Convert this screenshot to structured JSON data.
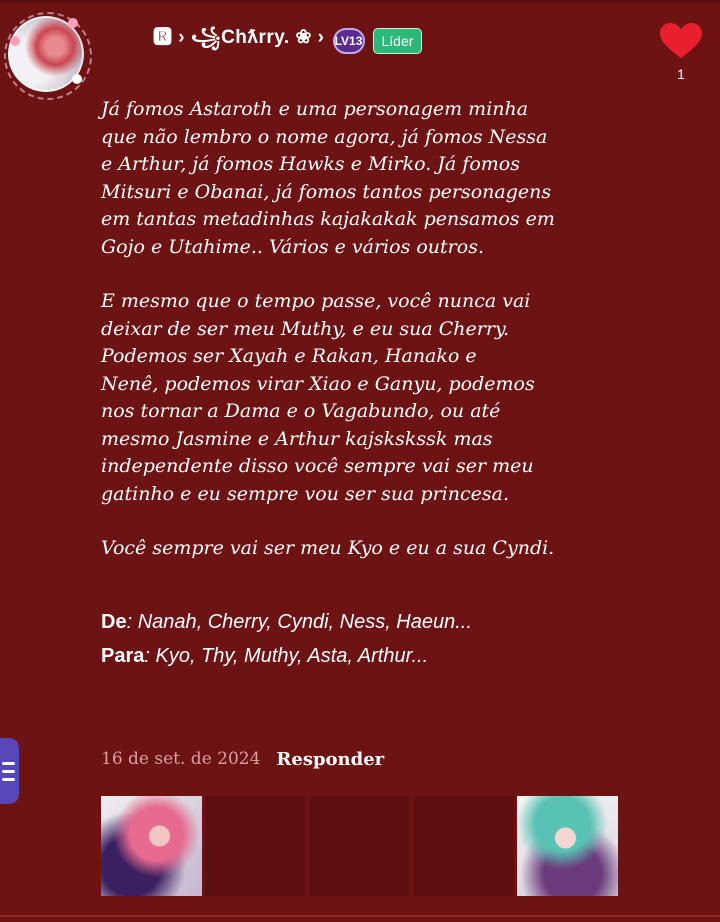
{
  "comment": {
    "username": "🆁 › ꧁Chƛrry. ❀ ›",
    "level_badge": "LV13",
    "role_badge": "Líder",
    "like_count": "1",
    "paragraphs": [
      "Já fomos Astaroth e uma personagem minha\nque não lembro o nome agora, já fomos Nessa\ne Arthur, já fomos Hawks e Mirko. Já fomos\nMitsuri e Obanai, já fomos tantos personagens\nem tantas metadinhas kajakakak pensamos em\nGojo e Utahime.. Vários e vários outros.",
      "E mesmo que o tempo passe, você nunca vai\ndeixar de ser meu Muthy, e eu sua Cherry.\nPodemos ser Xayah e Rakan, Hanako e\nNenê, podemos virar Xiao e Ganyu, podemos\nnos tornar a Dama e o Vagabundo, ou até\nmesmo Jasmine e Arthur kajskskssk mas\nindependente disso você sempre vai ser meu\ngatinho e eu sempre vou ser sua princesa.",
      "Você sempre vai ser meu Kyo e eu a sua Cyndi."
    ],
    "signature": {
      "from_label": "De",
      "from_value": ": Nanah, Cherry, Cyndi, Ness, Haeun...",
      "to_label": "Para",
      "to_value": ": Kyo, Thy, Muthy, Asta, Arthur..."
    },
    "date": "16 de set. de 2024",
    "reply_label": "Responder"
  },
  "colors": {
    "background": "#6e1313",
    "heart": "#e8202e",
    "role_badge": "#2bb879",
    "level_badge": "#5a2a8f",
    "side_tab": "#5847b8"
  },
  "icons": {
    "like": "heart-icon",
    "menu": "hamburger-menu-icon"
  }
}
